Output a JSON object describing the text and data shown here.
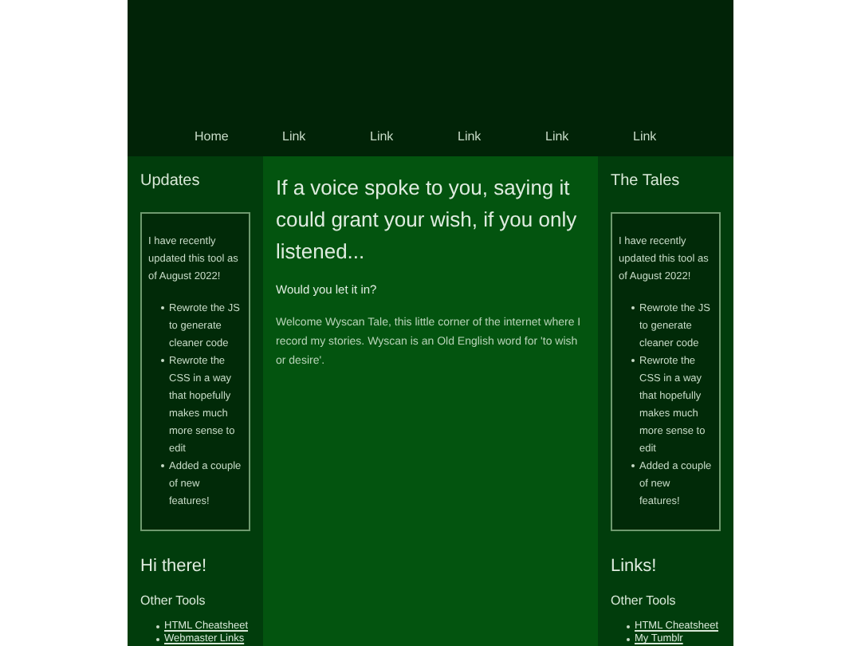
{
  "nav": [
    {
      "label": "Home"
    },
    {
      "label": "Link"
    },
    {
      "label": "Link"
    },
    {
      "label": "Link"
    },
    {
      "label": "Link"
    },
    {
      "label": "Link"
    }
  ],
  "left": {
    "title": "Updates",
    "box": {
      "intro": "I have recently updated this tool as of August 2022!",
      "items": [
        "Rewrote the JS to generate cleaner code",
        "Rewrote the CSS in a way that hopefully makes much more sense to edit",
        "Added a couple of new features!"
      ]
    },
    "heading": "Hi there!",
    "subheading": "Other Tools",
    "links": [
      "HTML Cheatsheet",
      "Webmaster Links"
    ]
  },
  "main": {
    "title": "If a voice spoke to you, saying it could grant your wish, if you only listened...",
    "subtitle": "Would you let it in?",
    "body": "Welcome Wyscan Tale, this little corner of the internet where I record my stories. Wyscan is an Old English word for 'to wish or desire'."
  },
  "right": {
    "title": "The Tales",
    "box": {
      "intro": "I have recently updated this tool as of August 2022!",
      "items": [
        "Rewrote the JS to generate cleaner code",
        "Rewrote the CSS in a way that hopefully makes much more sense to edit",
        "Added a couple of new features!"
      ]
    },
    "heading": "Links!",
    "subheading": "Other Tools",
    "links": [
      "HTML Cheatsheet",
      "My Tumblr"
    ]
  }
}
